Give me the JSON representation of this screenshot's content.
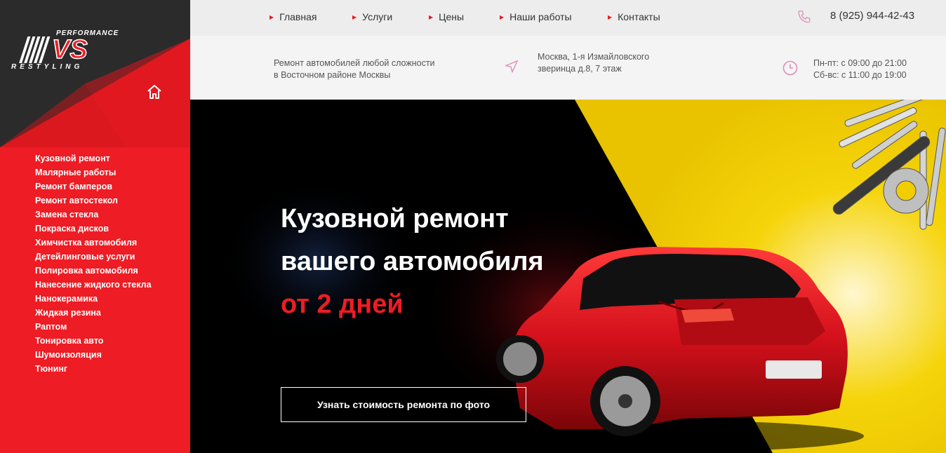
{
  "logo": {
    "top_word": "PERFORMANCE",
    "mark": "VS",
    "bottom_word": "RESTYLING"
  },
  "sidebar": {
    "items": [
      {
        "label": "Кузовной ремонт"
      },
      {
        "label": "Малярные работы"
      },
      {
        "label": "Ремонт бамперов"
      },
      {
        "label": "Ремонт автостекол"
      },
      {
        "label": "Замена стекла"
      },
      {
        "label": "Покраска дисков"
      },
      {
        "label": "Химчистка автомобиля"
      },
      {
        "label": "Детейлинговые услуги"
      },
      {
        "label": "Полировка автомобиля"
      },
      {
        "label": "Нанесение жидкого стекла"
      },
      {
        "label": "Нанокерамика"
      },
      {
        "label": "Жидкая резина"
      },
      {
        "label": "Раптом"
      },
      {
        "label": "Тонировка авто"
      },
      {
        "label": "Шумоизоляция"
      },
      {
        "label": "Тюнинг"
      }
    ]
  },
  "nav": {
    "items": [
      {
        "label": "Главная"
      },
      {
        "label": "Услуги"
      },
      {
        "label": "Цены"
      },
      {
        "label": "Наши работы"
      },
      {
        "label": "Контакты"
      }
    ],
    "phone": "8 (925) 944-42-43"
  },
  "info": {
    "description": [
      "Ремонт автомобилей любой сложности",
      "в Восточном районе Москвы"
    ],
    "address": [
      "Москва, 1-я Измайловского",
      "зверинца д.8, 7 этаж"
    ],
    "hours": [
      "Пн-пт: с 09:00 до 21:00",
      "Сб-вс: с 11:00 до 19:00"
    ]
  },
  "hero": {
    "title_line1": "Кузовной ремонт",
    "title_line2": "вашего автомобиля",
    "title_accent": "от 2 дней",
    "cta_label": "Узнать стоимость ремонта по фото"
  },
  "colors": {
    "brand_red": "#ee1c24",
    "dark": "#2b2b2b",
    "hero_yellow": "#f2cd00",
    "icon_pink": "#d98fb6"
  },
  "icons": [
    "home-icon",
    "phone-icon",
    "location-arrow-icon",
    "clock-icon",
    "nav-triangle-icon"
  ]
}
